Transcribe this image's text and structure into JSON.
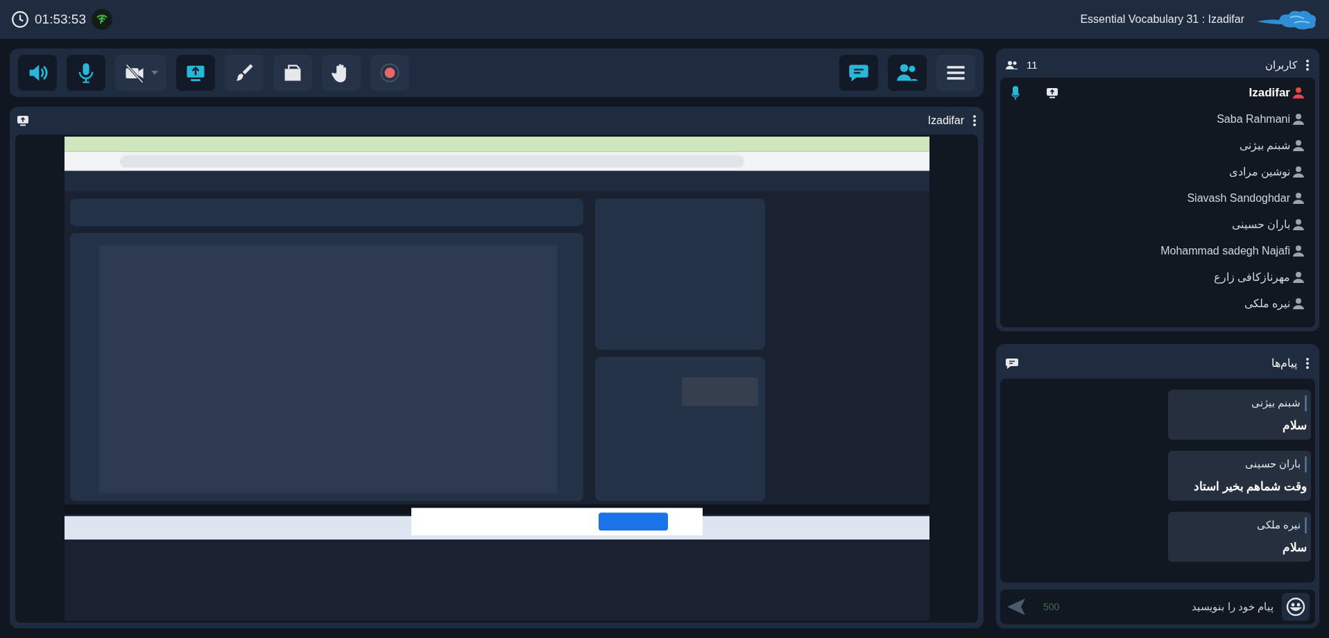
{
  "top_bar": {
    "time": "01:53:53",
    "title": "Essential Vocabulary 31 : Izadifar"
  },
  "toolbar": {
    "left": [
      {
        "kind": "speaker",
        "on": true
      },
      {
        "kind": "mic",
        "on": true
      },
      {
        "kind": "camera",
        "on": false
      },
      {
        "kind": "share",
        "on": true
      },
      {
        "kind": "brush",
        "on": false
      },
      {
        "kind": "files",
        "on": false
      },
      {
        "kind": "hand",
        "on": false
      },
      {
        "kind": "record",
        "on": false
      }
    ],
    "right": [
      {
        "kind": "chat",
        "on": true
      },
      {
        "kind": "users",
        "on": true
      },
      {
        "kind": "menu",
        "on": false
      }
    ]
  },
  "stage": {
    "presenter": "Izadifar"
  },
  "users": {
    "title": "کاربران",
    "count": "11",
    "items": [
      {
        "name": "Izadifar",
        "host": true
      },
      {
        "name": "Saba Rahmani",
        "host": false
      },
      {
        "name": "شبنم بیژنی",
        "host": false
      },
      {
        "name": "نوشین مرادی",
        "host": false
      },
      {
        "name": "Siavash Sandoghdar",
        "host": false
      },
      {
        "name": "باران حسینی",
        "host": false
      },
      {
        "name": "Mohammad sadegh Najafi",
        "host": false
      },
      {
        "name": "مهرنازکافی زارع",
        "host": false
      },
      {
        "name": "نیره ملکی",
        "host": false
      }
    ]
  },
  "messages": {
    "title": "پیام‌ها",
    "items": [
      {
        "sender": "شبنم بیژنی",
        "text": "سلام"
      },
      {
        "sender": "باران حسینی",
        "text": "وقت شماهم بخیر استاد"
      },
      {
        "sender": "نیره ملکی",
        "text": "سلام"
      }
    ],
    "input": {
      "placeholder": "پیام خود را بنویسید",
      "counter": "500"
    }
  }
}
